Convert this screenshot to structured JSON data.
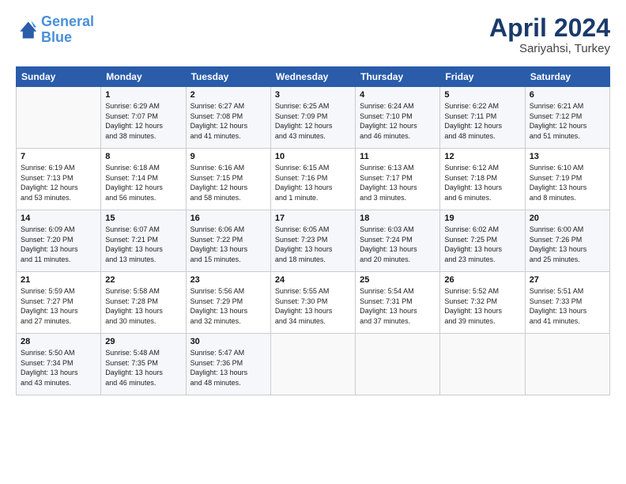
{
  "logo": {
    "line1": "General",
    "line2": "Blue"
  },
  "title": "April 2024",
  "location": "Sariyahsi, Turkey",
  "header_days": [
    "Sunday",
    "Monday",
    "Tuesday",
    "Wednesday",
    "Thursday",
    "Friday",
    "Saturday"
  ],
  "weeks": [
    [
      {
        "day": "",
        "info": ""
      },
      {
        "day": "1",
        "info": "Sunrise: 6:29 AM\nSunset: 7:07 PM\nDaylight: 12 hours\nand 38 minutes."
      },
      {
        "day": "2",
        "info": "Sunrise: 6:27 AM\nSunset: 7:08 PM\nDaylight: 12 hours\nand 41 minutes."
      },
      {
        "day": "3",
        "info": "Sunrise: 6:25 AM\nSunset: 7:09 PM\nDaylight: 12 hours\nand 43 minutes."
      },
      {
        "day": "4",
        "info": "Sunrise: 6:24 AM\nSunset: 7:10 PM\nDaylight: 12 hours\nand 46 minutes."
      },
      {
        "day": "5",
        "info": "Sunrise: 6:22 AM\nSunset: 7:11 PM\nDaylight: 12 hours\nand 48 minutes."
      },
      {
        "day": "6",
        "info": "Sunrise: 6:21 AM\nSunset: 7:12 PM\nDaylight: 12 hours\nand 51 minutes."
      }
    ],
    [
      {
        "day": "7",
        "info": "Sunrise: 6:19 AM\nSunset: 7:13 PM\nDaylight: 12 hours\nand 53 minutes."
      },
      {
        "day": "8",
        "info": "Sunrise: 6:18 AM\nSunset: 7:14 PM\nDaylight: 12 hours\nand 56 minutes."
      },
      {
        "day": "9",
        "info": "Sunrise: 6:16 AM\nSunset: 7:15 PM\nDaylight: 12 hours\nand 58 minutes."
      },
      {
        "day": "10",
        "info": "Sunrise: 6:15 AM\nSunset: 7:16 PM\nDaylight: 13 hours\nand 1 minute."
      },
      {
        "day": "11",
        "info": "Sunrise: 6:13 AM\nSunset: 7:17 PM\nDaylight: 13 hours\nand 3 minutes."
      },
      {
        "day": "12",
        "info": "Sunrise: 6:12 AM\nSunset: 7:18 PM\nDaylight: 13 hours\nand 6 minutes."
      },
      {
        "day": "13",
        "info": "Sunrise: 6:10 AM\nSunset: 7:19 PM\nDaylight: 13 hours\nand 8 minutes."
      }
    ],
    [
      {
        "day": "14",
        "info": "Sunrise: 6:09 AM\nSunset: 7:20 PM\nDaylight: 13 hours\nand 11 minutes."
      },
      {
        "day": "15",
        "info": "Sunrise: 6:07 AM\nSunset: 7:21 PM\nDaylight: 13 hours\nand 13 minutes."
      },
      {
        "day": "16",
        "info": "Sunrise: 6:06 AM\nSunset: 7:22 PM\nDaylight: 13 hours\nand 15 minutes."
      },
      {
        "day": "17",
        "info": "Sunrise: 6:05 AM\nSunset: 7:23 PM\nDaylight: 13 hours\nand 18 minutes."
      },
      {
        "day": "18",
        "info": "Sunrise: 6:03 AM\nSunset: 7:24 PM\nDaylight: 13 hours\nand 20 minutes."
      },
      {
        "day": "19",
        "info": "Sunrise: 6:02 AM\nSunset: 7:25 PM\nDaylight: 13 hours\nand 23 minutes."
      },
      {
        "day": "20",
        "info": "Sunrise: 6:00 AM\nSunset: 7:26 PM\nDaylight: 13 hours\nand 25 minutes."
      }
    ],
    [
      {
        "day": "21",
        "info": "Sunrise: 5:59 AM\nSunset: 7:27 PM\nDaylight: 13 hours\nand 27 minutes."
      },
      {
        "day": "22",
        "info": "Sunrise: 5:58 AM\nSunset: 7:28 PM\nDaylight: 13 hours\nand 30 minutes."
      },
      {
        "day": "23",
        "info": "Sunrise: 5:56 AM\nSunset: 7:29 PM\nDaylight: 13 hours\nand 32 minutes."
      },
      {
        "day": "24",
        "info": "Sunrise: 5:55 AM\nSunset: 7:30 PM\nDaylight: 13 hours\nand 34 minutes."
      },
      {
        "day": "25",
        "info": "Sunrise: 5:54 AM\nSunset: 7:31 PM\nDaylight: 13 hours\nand 37 minutes."
      },
      {
        "day": "26",
        "info": "Sunrise: 5:52 AM\nSunset: 7:32 PM\nDaylight: 13 hours\nand 39 minutes."
      },
      {
        "day": "27",
        "info": "Sunrise: 5:51 AM\nSunset: 7:33 PM\nDaylight: 13 hours\nand 41 minutes."
      }
    ],
    [
      {
        "day": "28",
        "info": "Sunrise: 5:50 AM\nSunset: 7:34 PM\nDaylight: 13 hours\nand 43 minutes."
      },
      {
        "day": "29",
        "info": "Sunrise: 5:48 AM\nSunset: 7:35 PM\nDaylight: 13 hours\nand 46 minutes."
      },
      {
        "day": "30",
        "info": "Sunrise: 5:47 AM\nSunset: 7:36 PM\nDaylight: 13 hours\nand 48 minutes."
      },
      {
        "day": "",
        "info": ""
      },
      {
        "day": "",
        "info": ""
      },
      {
        "day": "",
        "info": ""
      },
      {
        "day": "",
        "info": ""
      }
    ]
  ]
}
